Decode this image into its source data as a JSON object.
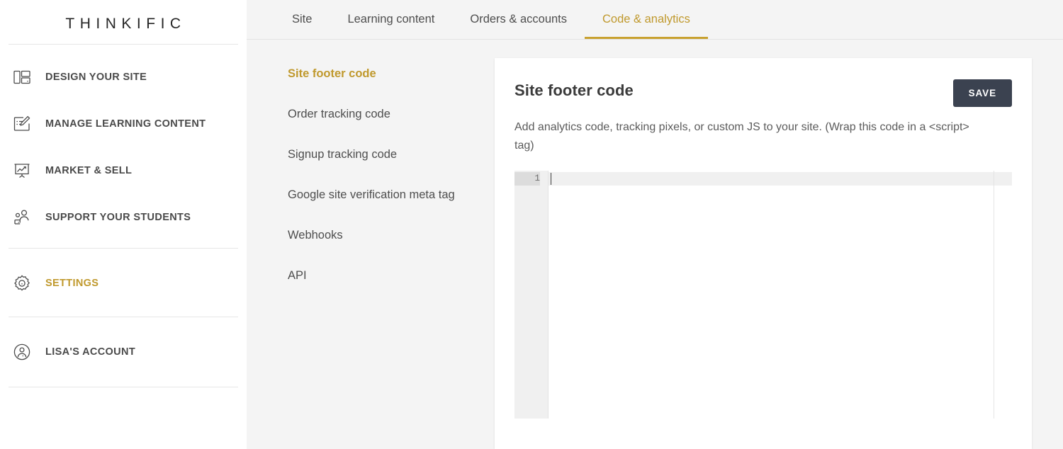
{
  "sidebar": {
    "brand": "THINKIFIC",
    "groups": [
      {
        "name": "primary",
        "items": [
          {
            "label": "DESIGN YOUR SITE",
            "icon": "layout-panels-icon",
            "active": false
          },
          {
            "label": "MANAGE LEARNING CONTENT",
            "icon": "edit-pencil-icon",
            "active": false
          },
          {
            "label": "MARKET & SELL",
            "icon": "presentation-chart-icon",
            "active": false
          },
          {
            "label": "SUPPORT YOUR STUDENTS",
            "icon": "students-people-icon",
            "active": false
          }
        ]
      },
      {
        "name": "settings",
        "items": [
          {
            "label": "SETTINGS",
            "icon": "gear-icon",
            "active": true
          }
        ]
      },
      {
        "name": "account",
        "items": [
          {
            "label": "LISA'S ACCOUNT",
            "icon": "user-avatar-icon",
            "active": false
          }
        ]
      }
    ]
  },
  "tabs": [
    {
      "label": "Site",
      "active": false
    },
    {
      "label": "Learning content",
      "active": false
    },
    {
      "label": "Orders & accounts",
      "active": false
    },
    {
      "label": "Code & analytics",
      "active": true
    }
  ],
  "subnav": [
    {
      "label": "Site footer code",
      "active": true
    },
    {
      "label": "Order tracking code",
      "active": false
    },
    {
      "label": "Signup tracking code",
      "active": false
    },
    {
      "label": "Google site verification meta tag",
      "active": false
    },
    {
      "label": "Webhooks",
      "active": false
    },
    {
      "label": "API",
      "active": false
    }
  ],
  "panel": {
    "title": "Site footer code",
    "save_label": "SAVE",
    "description": "Add analytics code, tracking pixels, or custom JS to your site. (Wrap this code in a <script> tag)",
    "editor": {
      "line_numbers": [
        "1"
      ],
      "content": "",
      "active_line": 1
    }
  },
  "colors": {
    "accent_gold": "#c0992d",
    "tab_underline": "#c8a12f",
    "save_button_bg": "#3b4250",
    "content_bg": "#f4f4f4",
    "sidebar_bg": "#ffffff",
    "text_primary": "#4a4a4a"
  }
}
